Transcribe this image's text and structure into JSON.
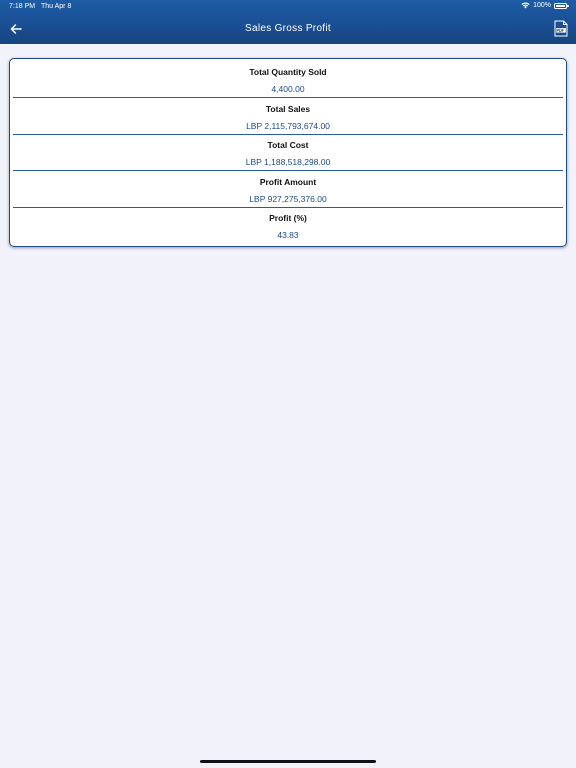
{
  "status_bar": {
    "time": "7:18 PM",
    "date": "Thu Apr 8",
    "battery": "100%"
  },
  "nav": {
    "title": "Sales Gross Profit",
    "back_icon": "arrow-left-icon",
    "pdf_icon": "pdf-document-icon"
  },
  "summary": {
    "rows": [
      {
        "label": "Total Quantity Sold",
        "value": "4,400.00"
      },
      {
        "label": "Total Sales",
        "value": "LBP 2,115,793,674.00"
      },
      {
        "label": "Total Cost",
        "value": "LBP 1,188,518,298.00"
      },
      {
        "label": "Profit Amount",
        "value": "LBP 927,275,376.00"
      },
      {
        "label": "Profit (%)",
        "value": "43.83"
      }
    ]
  },
  "colors": {
    "header": "#1a4f93",
    "value_text": "#1e4a86",
    "background": "#f1f2fa"
  }
}
